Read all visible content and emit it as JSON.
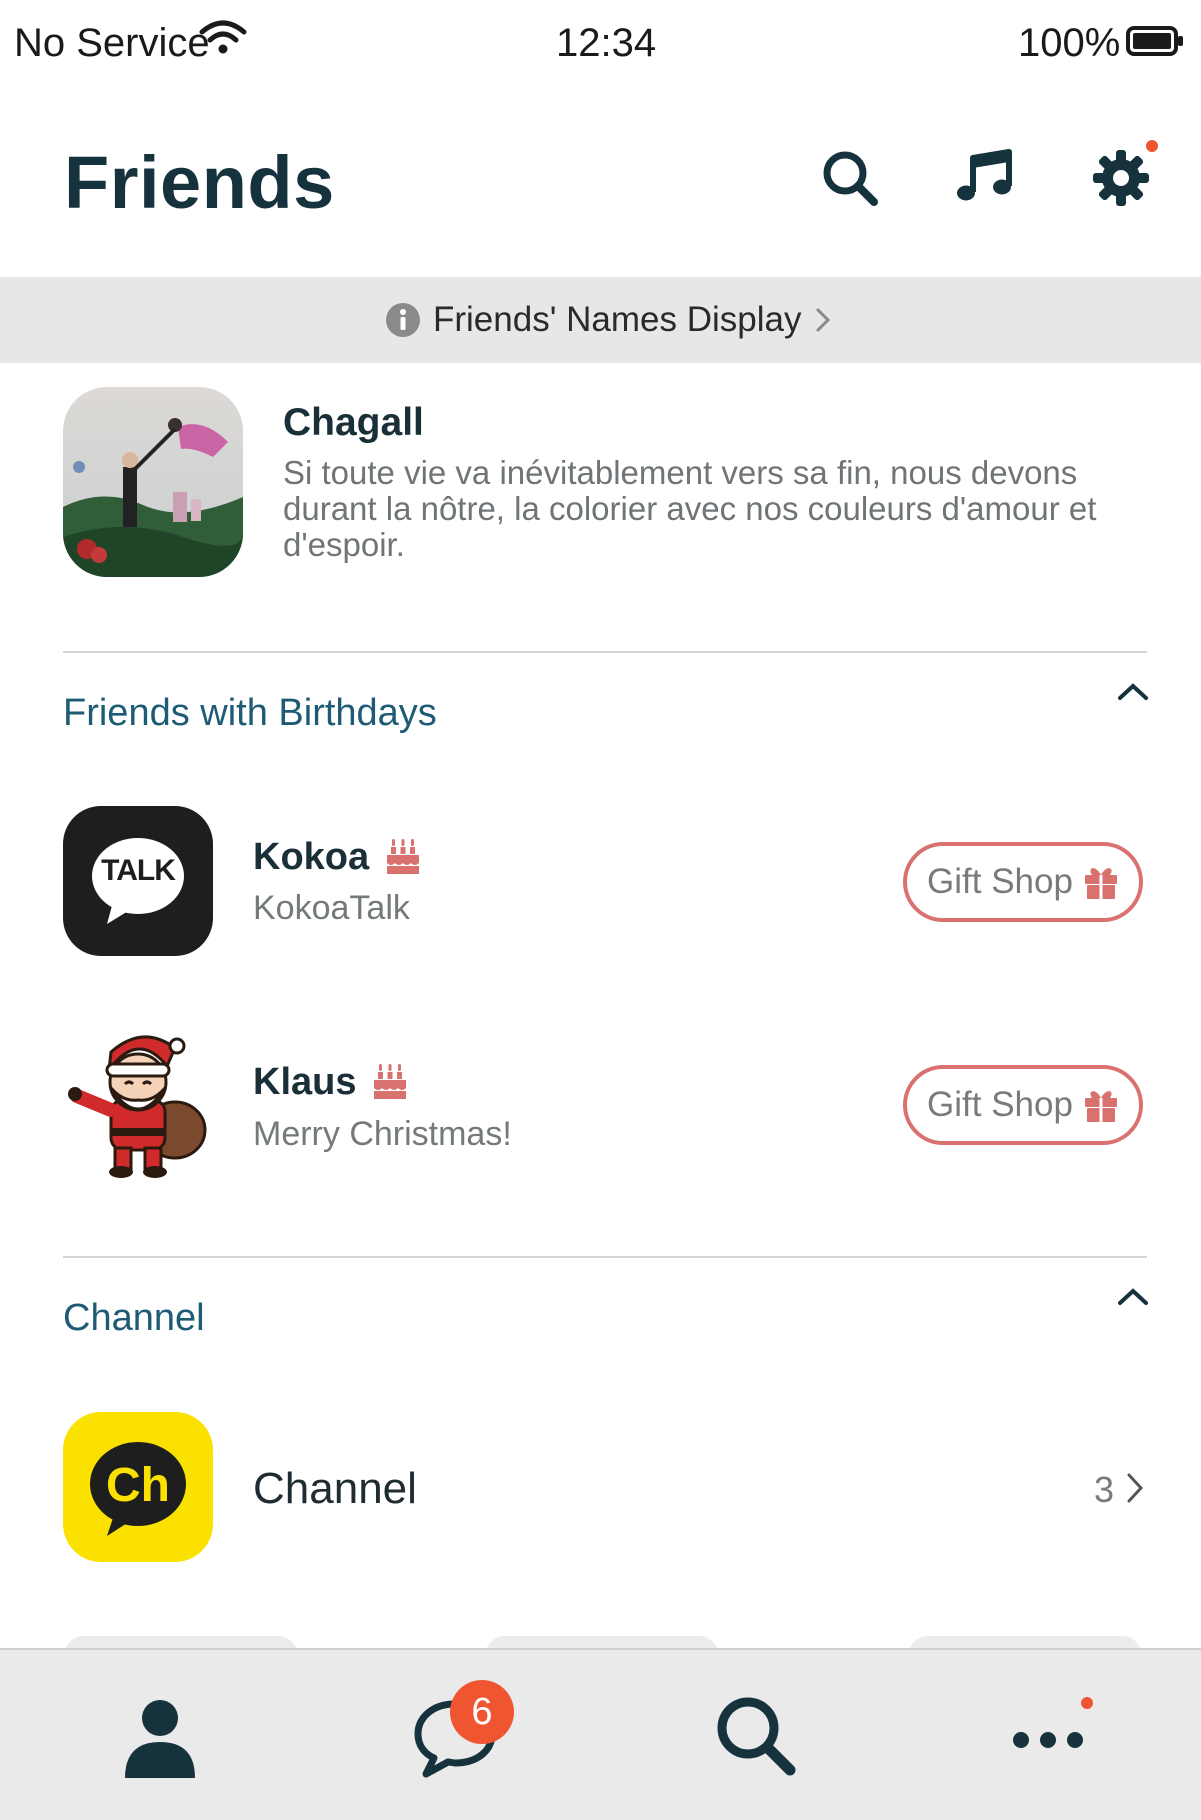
{
  "status_bar": {
    "carrier": "No Service",
    "time": "12:34",
    "battery": "100%"
  },
  "header": {
    "title": "Friends",
    "icons": [
      "search-icon",
      "music-icon",
      "settings-icon"
    ],
    "settings_has_notification": true
  },
  "notice": {
    "label": "Friends' Names Display"
  },
  "profile": {
    "name": "Chagall",
    "status_message": "Si toute vie va inévitablement vers sa fin, nous devons durant la nôtre, la colorier avec nos couleurs d'amour et d'espoir."
  },
  "birthdays": {
    "title": "Friends with Birthdays",
    "items": [
      {
        "name": "Kokoa",
        "subtitle": "KokoaTalk",
        "avatar_text": "TALK",
        "button_label": "Gift Shop"
      },
      {
        "name": "Klaus",
        "subtitle": "Merry Christmas!",
        "button_label": "Gift Shop"
      }
    ]
  },
  "channel": {
    "title": "Channel",
    "item_label": "Channel",
    "avatar_text": "Ch",
    "count": "3"
  },
  "tab_bar": {
    "tabs": [
      "friends-tab",
      "chats-tab",
      "search-tab",
      "more-tab"
    ],
    "chats_badge": "6",
    "more_has_notification": true
  },
  "colors": {
    "title": "#16323d",
    "section": "#1e5b75",
    "gift_border": "#d9716e",
    "badge": "#f05532",
    "channel_yellow": "#fae100"
  }
}
